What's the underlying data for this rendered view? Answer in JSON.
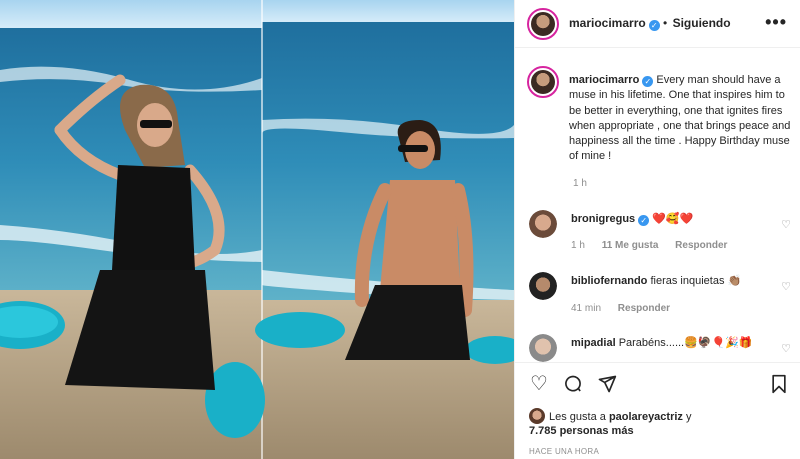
{
  "post": {
    "username": "mariocimarro",
    "follow_status": "Siguiendo",
    "more_icon": "more-options-icon",
    "caption": "Every man should have a muse in his lifetime. One that inspires him to be better in everything, one that ignites fires when appropriate , one that brings peace and happiness all the time . Happy Birthday muse of mine !",
    "time": "1 h"
  },
  "comments": [
    {
      "username": "bronigregus",
      "verified": true,
      "text": "❤️🥰❤️",
      "time": "1 h",
      "likes": "11 Me gusta",
      "reply": "Responder"
    },
    {
      "username": "bibliofernando",
      "verified": false,
      "text": "fieras inquietas 👏🏽",
      "time": "41 min",
      "likes": "",
      "reply": "Responder"
    },
    {
      "username": "mipadial",
      "verified": false,
      "text": "Parabéns......🍔🦃🎈🎉🎁",
      "time": "",
      "likes": "",
      "reply": ""
    }
  ],
  "actions": {
    "like_icon": "heart-icon",
    "comment_icon": "comment-icon",
    "share_icon": "share-icon",
    "save_icon": "bookmark-icon"
  },
  "likes": {
    "line1_prefix": "Les gusta a ",
    "line1_user": "paolareyactriz",
    "line1_suffix": " y",
    "line2": "7.785 personas más"
  },
  "posted_ago": "HACE UNA HORA",
  "colors": {
    "verified": "#3897f0",
    "story_ring": "#d6249f",
    "secondary_text": "#8e8e8e"
  }
}
